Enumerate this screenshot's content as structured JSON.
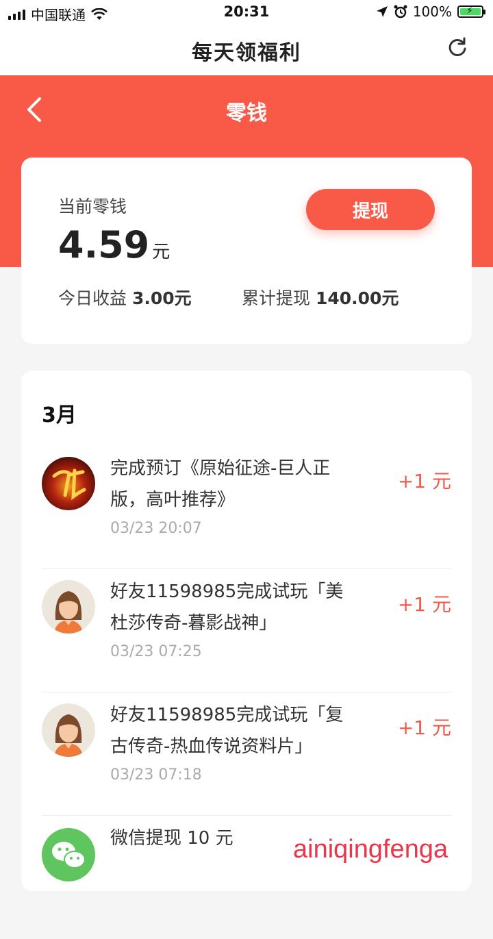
{
  "status_bar": {
    "carrier": "中国联通",
    "time": "20:31",
    "battery": "100%"
  },
  "nav": {
    "title": "每天领福利"
  },
  "header": {
    "title": "零钱"
  },
  "balance": {
    "label": "当前零钱",
    "value": "4.59",
    "unit": "元",
    "withdraw_label": "提现",
    "today_label": "今日收益",
    "today_value": "3.00元",
    "total_label": "累计提现",
    "total_value": "140.00元"
  },
  "records": {
    "month": "3月",
    "items": [
      {
        "title": "完成预订《原始征途-巨人正版，高叶推荐》",
        "time": "03/23 20:07",
        "amount": "+1 元",
        "avatar": "game-icon"
      },
      {
        "title": "好友11598985完成试玩「美杜莎传奇-暮影战神」",
        "time": "03/23 07:25",
        "amount": "+1 元",
        "avatar": "user-avatar-icon"
      },
      {
        "title": "好友11598985完成试玩「复古传奇-热血传说资料片」",
        "time": "03/23 07:18",
        "amount": "+1 元",
        "avatar": "user-avatar-icon"
      },
      {
        "title": "微信提现 10 元",
        "time": "",
        "amount": "",
        "avatar": "wechat-icon"
      }
    ]
  },
  "watermark": "ainiqingfenga"
}
